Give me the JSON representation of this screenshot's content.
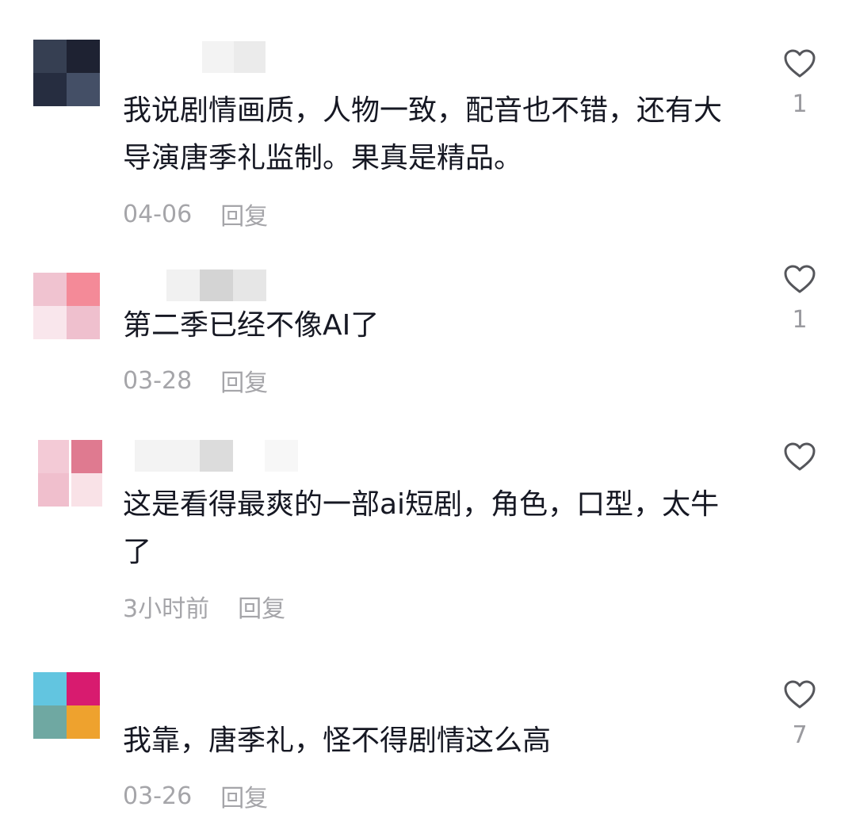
{
  "comments": [
    {
      "text": "我说剧情画质，人物一致，配音也不错，还有大导演唐季礼监制。果真是精品。",
      "date": "04-06",
      "reply_label": "回复",
      "likes": "1",
      "avatar_colors": [
        "#363f52",
        "#1e2232",
        "#262d40",
        "#444f66"
      ],
      "username_blur_colors": [
        "#f4f4f4",
        "#ececec"
      ]
    },
    {
      "text": "第二季已经不像AI了",
      "date": "03-28",
      "reply_label": "回复",
      "likes": "1",
      "avatar_colors": [
        "#f0c3d0",
        "#f48a98",
        "#f9e6ec",
        "#efc0ce"
      ],
      "username_blur_colors": [
        "#f0f0f0",
        "#cfcfcf",
        "#e2e2e2"
      ]
    },
    {
      "text": "这是看得最爽的一部ai短剧，角色，口型，太牛了",
      "date": "3小时前",
      "reply_label": "回复",
      "likes": "",
      "avatar_colors": [
        "#f3cad6",
        "#df7a90",
        "#f0bfcd",
        "#f9e2e7"
      ],
      "username_blur_colors": [
        "#f3f3f3",
        "#dcdcdc",
        "#f6f6f6"
      ]
    },
    {
      "text": "我靠，唐季礼，怪不得剧情这么高",
      "date": "03-26",
      "reply_label": "回复",
      "likes": "7",
      "avatar_colors": [
        "#62c5e0",
        "#d81b6f",
        "#6fa8a2",
        "#eea22e"
      ],
      "username_blur_colors": []
    }
  ],
  "icons": {
    "like": "heart-outline-icon"
  }
}
